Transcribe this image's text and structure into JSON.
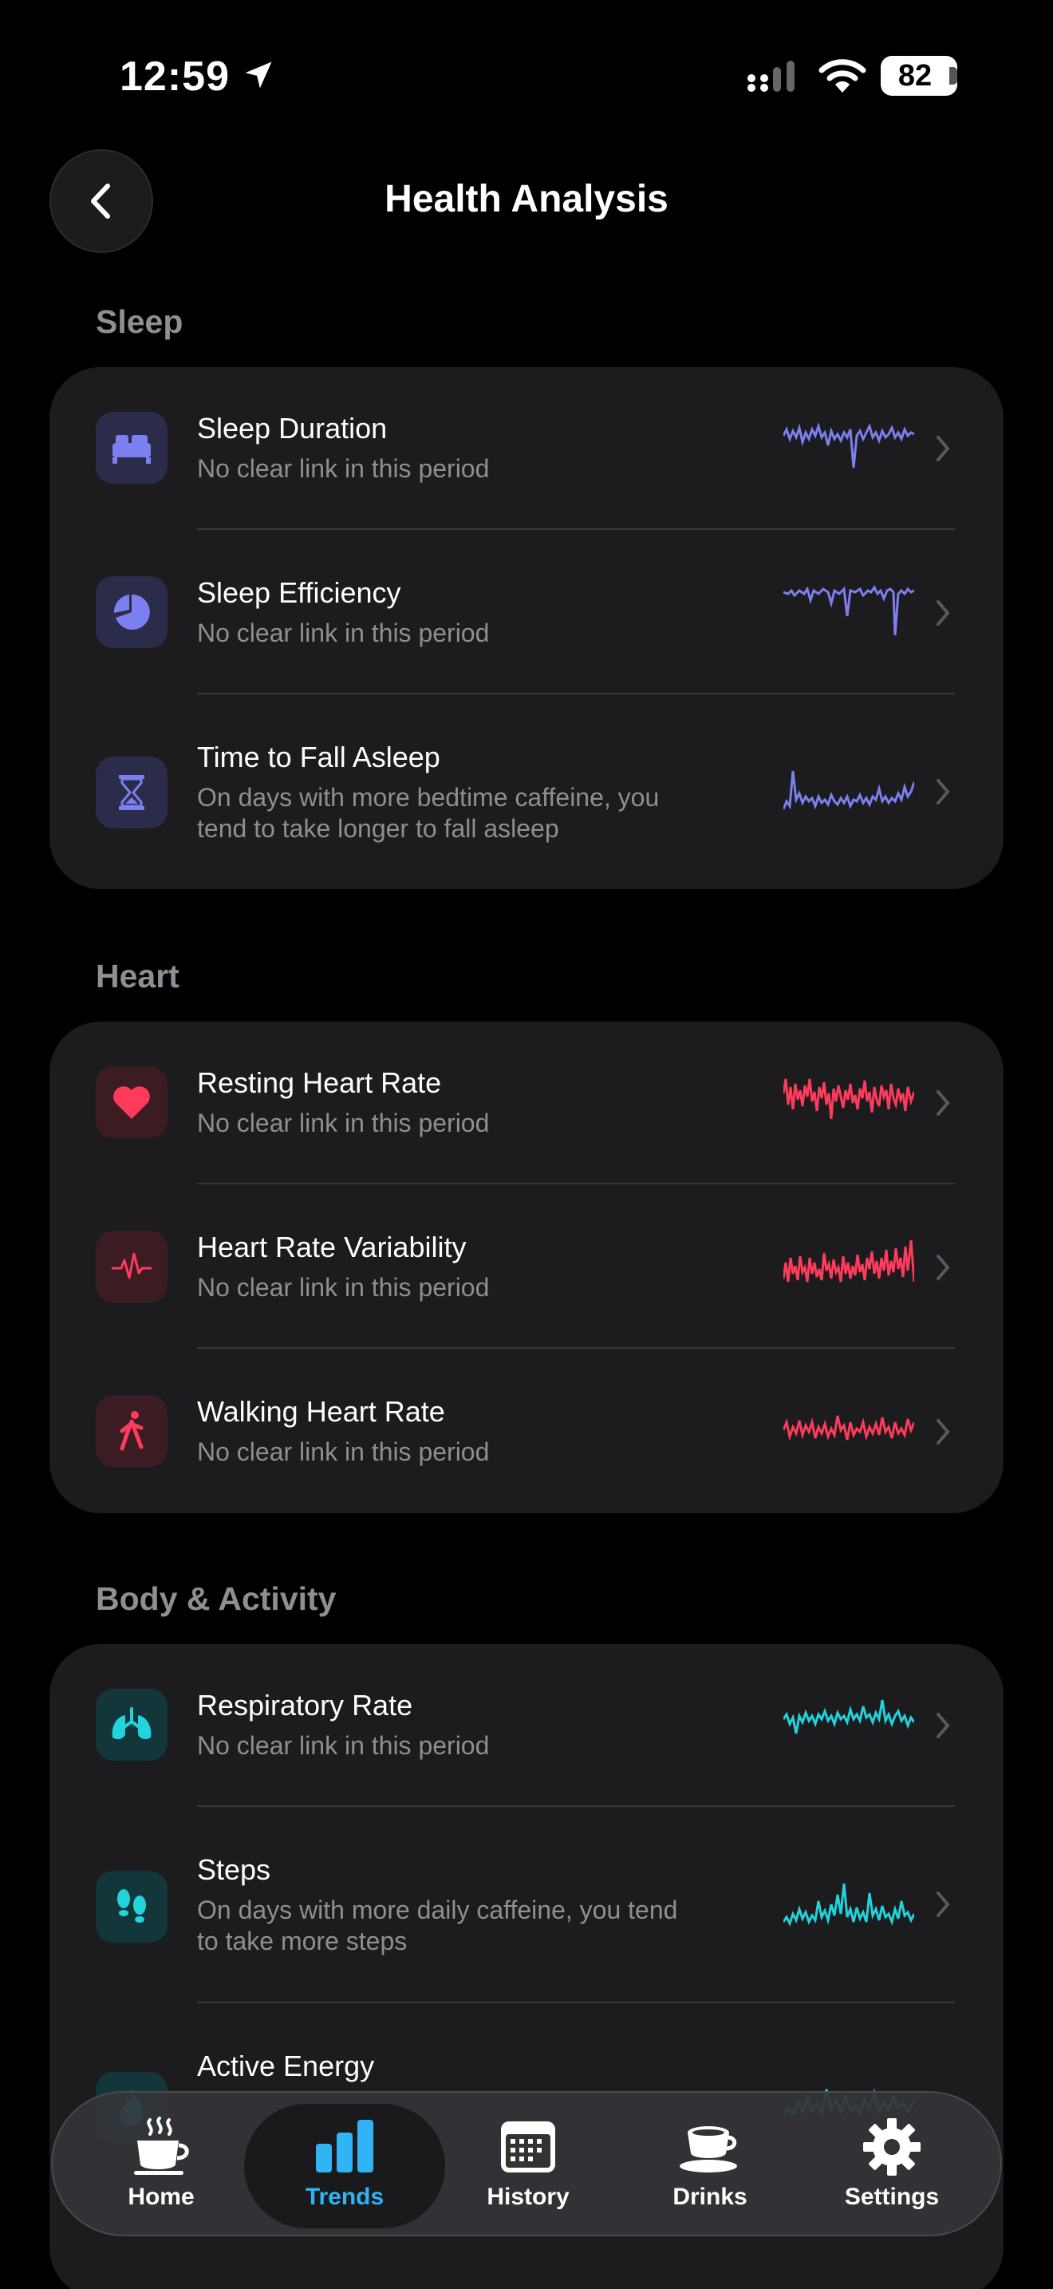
{
  "status_bar": {
    "time": "12:59",
    "battery": "82"
  },
  "header": {
    "title": "Health Analysis"
  },
  "sections": [
    {
      "title": "Sleep",
      "rows": [
        {
          "title": "Sleep Duration",
          "subtitle": "No clear link in this period",
          "icon": "bed-icon"
        },
        {
          "title": "Sleep Efficiency",
          "subtitle": "No clear link in this period",
          "icon": "pie-chart-icon"
        },
        {
          "title": "Time to Fall Asleep",
          "subtitle": "On days with more bedtime caffeine, you tend to take longer to fall asleep",
          "icon": "hourglass-icon"
        }
      ]
    },
    {
      "title": "Heart",
      "rows": [
        {
          "title": "Resting Heart Rate",
          "subtitle": "No clear link in this period",
          "icon": "heart-icon"
        },
        {
          "title": "Heart Rate Variability",
          "subtitle": "No clear link in this period",
          "icon": "waveform-icon"
        },
        {
          "title": "Walking Heart Rate",
          "subtitle": "No clear link in this period",
          "icon": "walking-icon"
        }
      ]
    },
    {
      "title": "Body & Activity",
      "rows": [
        {
          "title": "Respiratory Rate",
          "subtitle": "No clear link in this period",
          "icon": "lungs-icon"
        },
        {
          "title": "Steps",
          "subtitle": "On days with more daily caffeine, you tend to take more steps",
          "icon": "footprints-icon"
        },
        {
          "title": "Active Energy",
          "subtitle": "",
          "icon": "flame-icon"
        }
      ]
    }
  ],
  "tabs": [
    {
      "label": "Home",
      "icon": "coffee-cup-icon",
      "active": false
    },
    {
      "label": "Trends",
      "icon": "bar-chart-icon",
      "active": true
    },
    {
      "label": "History",
      "icon": "calendar-icon",
      "active": false
    },
    {
      "label": "Drinks",
      "icon": "cup-saucer-icon",
      "active": false
    },
    {
      "label": "Settings",
      "icon": "gear-icon",
      "active": false
    }
  ],
  "colors": {
    "sleep": "#7b7ff0",
    "heart": "#ff3b5c",
    "body": "#22d3dc",
    "active_tab": "#30b4f5",
    "card": "#1c1c1e"
  }
}
